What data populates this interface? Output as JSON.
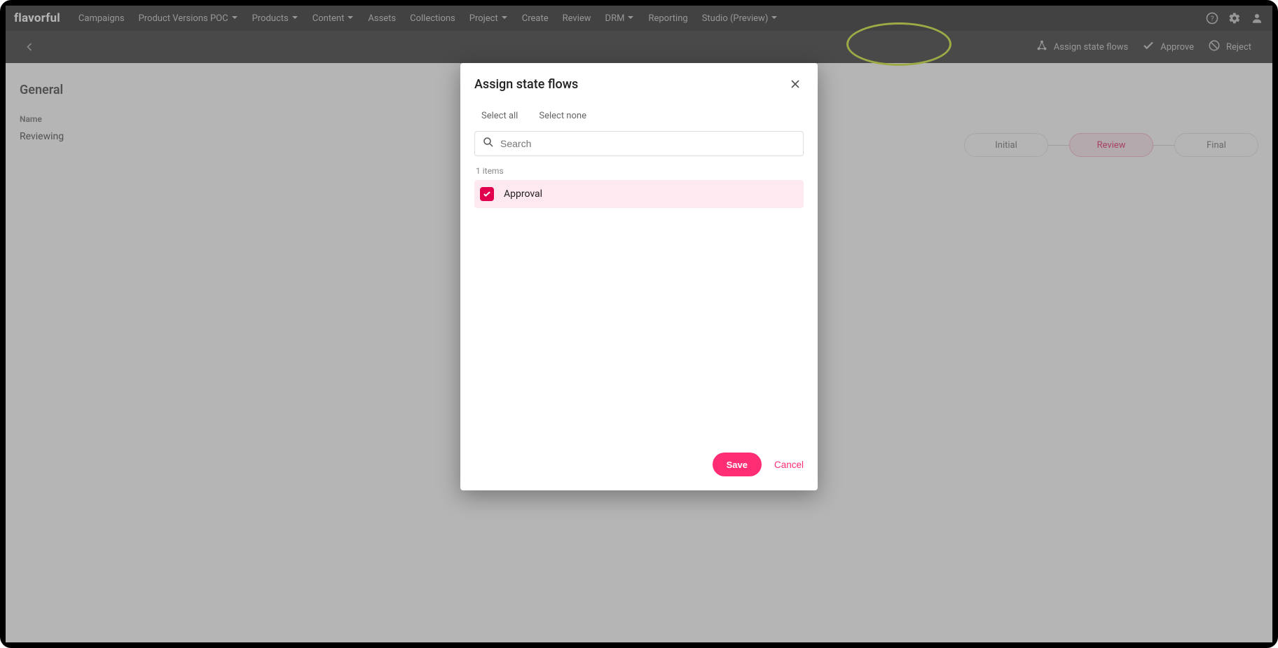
{
  "brand": "flavorful",
  "nav": {
    "items": [
      {
        "label": "Campaigns",
        "dropdown": false
      },
      {
        "label": "Product Versions POC",
        "dropdown": true
      },
      {
        "label": "Products",
        "dropdown": true
      },
      {
        "label": "Content",
        "dropdown": true
      },
      {
        "label": "Assets",
        "dropdown": false
      },
      {
        "label": "Collections",
        "dropdown": false
      },
      {
        "label": "Project",
        "dropdown": true
      },
      {
        "label": "Create",
        "dropdown": false
      },
      {
        "label": "Review",
        "dropdown": false
      },
      {
        "label": "DRM",
        "dropdown": true
      },
      {
        "label": "Reporting",
        "dropdown": false
      },
      {
        "label": "Studio (Preview)",
        "dropdown": true
      }
    ]
  },
  "subheader": {
    "actions": {
      "assign": "Assign state flows",
      "approve": "Approve",
      "reject": "Reject"
    }
  },
  "page": {
    "section_title": "General",
    "field_label": "Name",
    "field_value": "Reviewing"
  },
  "workflow": {
    "steps": [
      "Initial",
      "Review",
      "Final"
    ],
    "active_index": 1
  },
  "modal": {
    "title": "Assign state flows",
    "select_all": "Select all",
    "select_none": "Select none",
    "search_placeholder": "Search",
    "count_text": "1 items",
    "items": [
      {
        "label": "Approval",
        "checked": true
      }
    ],
    "save": "Save",
    "cancel": "Cancel"
  }
}
